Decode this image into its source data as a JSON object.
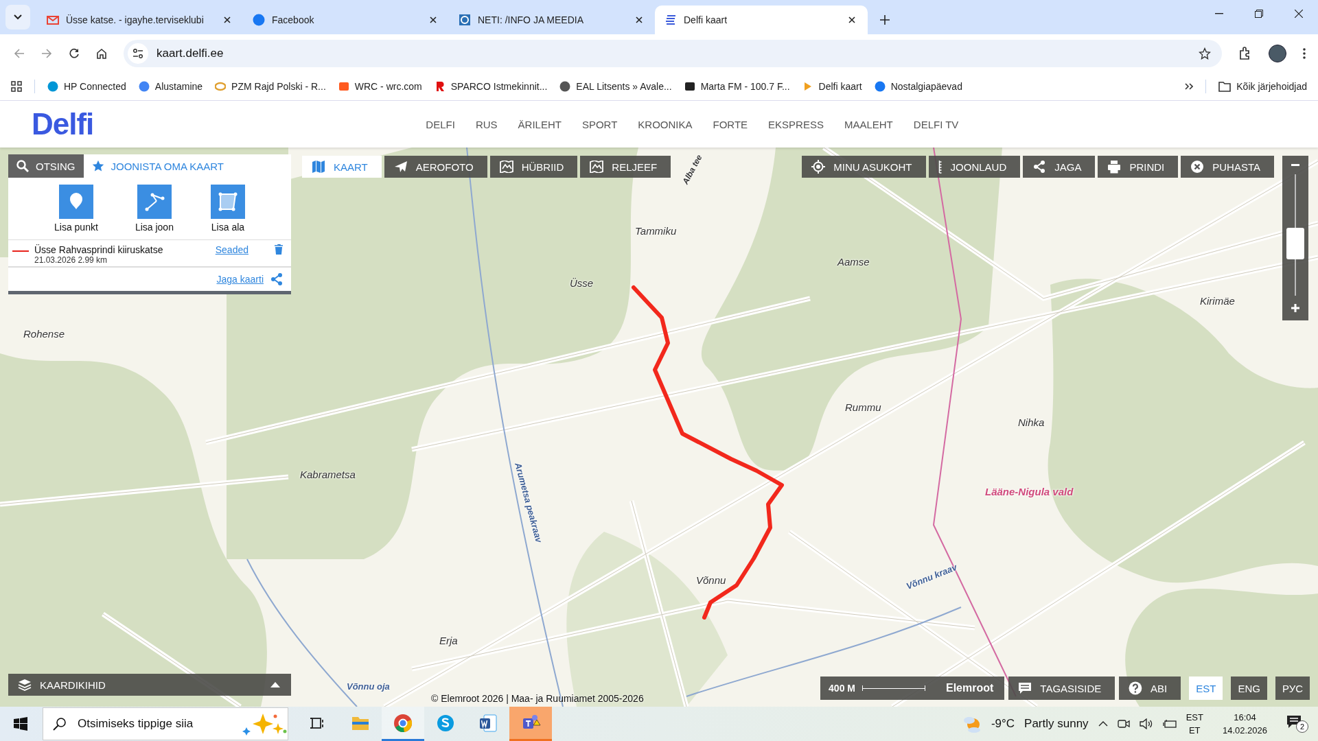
{
  "browser": {
    "tabs": [
      {
        "title": "Üsse katse. - igayhe.terviseklubi",
        "selected": false
      },
      {
        "title": "Facebook",
        "selected": false
      },
      {
        "title": "NETI: /INFO JA MEEDIA",
        "selected": false
      },
      {
        "title": "Delfi kaart",
        "selected": true
      }
    ],
    "address": "kaart.delfi.ee",
    "bookmarks": [
      {
        "label": "HP Connected"
      },
      {
        "label": "Alustamine"
      },
      {
        "label": "PZM Rajd Polski - R..."
      },
      {
        "label": "WRC - wrc.com"
      },
      {
        "label": "SPARCO Istmekinnit..."
      },
      {
        "label": "EAL Litsents » Avale..."
      },
      {
        "label": "Marta FM - 100.7 F..."
      },
      {
        "label": "Delfi kaart"
      },
      {
        "label": "Nostalgiapäevad"
      }
    ],
    "all_bookmarks": "Kõik järjehoidjad"
  },
  "site": {
    "logo": "Delfi",
    "nav": [
      "DELFI",
      "RUS",
      "ÄRILEHT",
      "SPORT",
      "KROONIKA",
      "FORTE",
      "EKSPRESS",
      "MAALEHT",
      "DELFI TV"
    ]
  },
  "panel": {
    "tabs": [
      {
        "label": "OTSING",
        "selected": false
      },
      {
        "label": "JOONISTA OMA KAART",
        "selected": true
      }
    ],
    "tools": [
      {
        "label": "Lisa punkt"
      },
      {
        "label": "Lisa joon"
      },
      {
        "label": "Lisa ala"
      }
    ],
    "drawings": [
      {
        "color": "#e8231b",
        "title": "Üsse Rahvasprindi kiiruskatse",
        "meta": "21.03.2026 2.99 km",
        "settings": "Seaded"
      }
    ],
    "share": "Jaga kaarti"
  },
  "map": {
    "types": [
      {
        "label": "KAART",
        "selected": true
      },
      {
        "label": "AEROFOTO",
        "selected": false
      },
      {
        "label": "HÜBRIID",
        "selected": false
      },
      {
        "label": "RELJEEF",
        "selected": false
      }
    ],
    "tools": [
      {
        "label": "MINU ASUKOHT"
      },
      {
        "label": "JOONLAUD"
      },
      {
        "label": "JAGA"
      },
      {
        "label": "PRINDI"
      },
      {
        "label": "PUHASTA"
      }
    ],
    "zoom": {
      "level": 0.43
    },
    "labels": [
      {
        "kind": "road",
        "text": "Alba tee"
      },
      {
        "kind": "place",
        "text": "Tammiku"
      },
      {
        "kind": "place",
        "text": "Aamse"
      },
      {
        "kind": "place",
        "text": "Üsse"
      },
      {
        "kind": "place",
        "text": "Kirimäe"
      },
      {
        "kind": "place",
        "text": "Rohense"
      },
      {
        "kind": "place",
        "text": "Rummu"
      },
      {
        "kind": "place",
        "text": "Nihka"
      },
      {
        "kind": "place",
        "text": "Kabrametsa"
      },
      {
        "kind": "admin",
        "text": "Lääne-Nigula vald"
      },
      {
        "kind": "water",
        "text": "Arumetsa peakraav"
      },
      {
        "kind": "place",
        "text": "Võnnu"
      },
      {
        "kind": "water",
        "text": "Võnnu kraav"
      },
      {
        "kind": "place",
        "text": "Erja"
      },
      {
        "kind": "water",
        "text": "Võnnu oja"
      }
    ],
    "route": {
      "color": "#f2281c"
    },
    "layers": "KAARDIKIHID",
    "copyright": "© Elemroot 2026 | Maa- ja Ruumiamet 2005-2026",
    "scale": "400 M",
    "brand": "Elemroot",
    "feedback": "TAGASISIDE",
    "help": "ABI",
    "languages": [
      {
        "label": "EST",
        "selected": true
      },
      {
        "label": "ENG",
        "selected": false
      },
      {
        "label": "РУС",
        "selected": false
      }
    ]
  },
  "taskbar": {
    "search": {
      "placeholder": "Otsimiseks tippige siia"
    },
    "apps": [
      {
        "active": false,
        "flagged": false
      },
      {
        "active": false,
        "flagged": false
      },
      {
        "active": true,
        "flagged": false
      },
      {
        "active": false,
        "flagged": false
      },
      {
        "active": false,
        "flagged": false
      },
      {
        "active": false,
        "flagged": true
      }
    ],
    "temperature": "-9°C",
    "weather": "Partly sunny",
    "lang": "EST",
    "layout": "ET",
    "time": "16:04",
    "date": "14.02.2026",
    "notifications": "2"
  }
}
